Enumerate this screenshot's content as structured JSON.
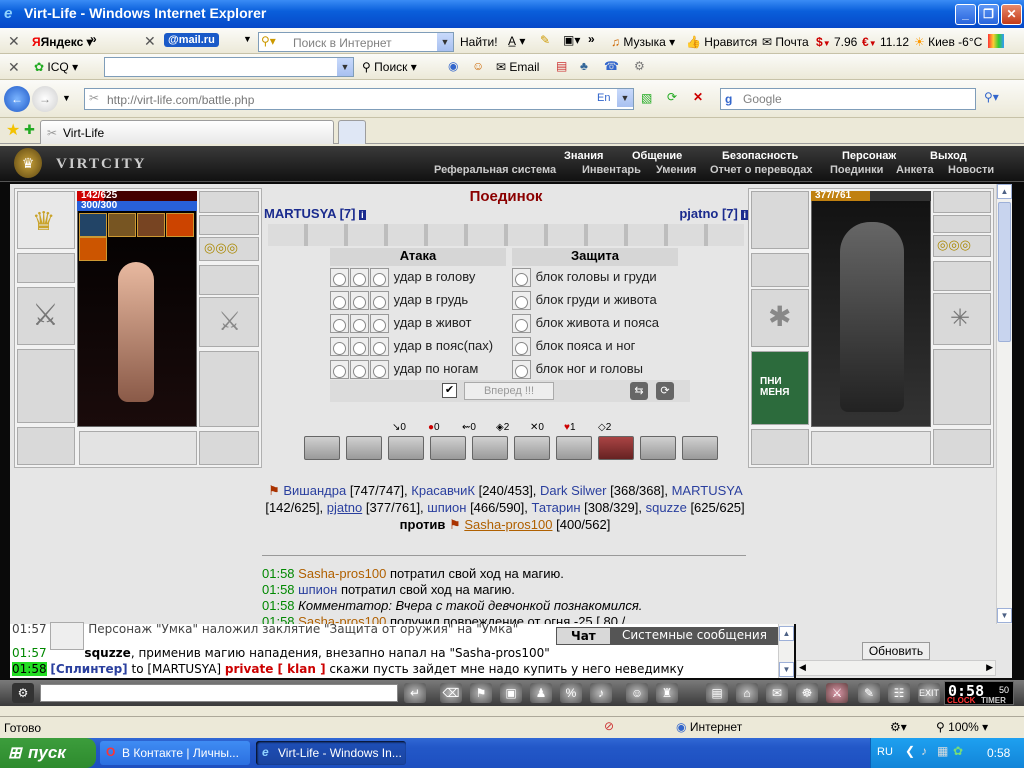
{
  "window": {
    "title": "Virt-Life - Windows Internet Explorer"
  },
  "toolbar1": {
    "yandex": "Яндекс",
    "mail": "@mail.ru",
    "search_placeholder": "Поиск в Интернет",
    "find": "Найти!",
    "music": "Музыка",
    "like": "Нравится",
    "mail_label": "Почта",
    "usd": "7.96",
    "eur": "11.12",
    "weather": "Киев -6°C"
  },
  "toolbar2": {
    "icq": "ICQ",
    "search": "Поиск",
    "email": "Email"
  },
  "address": {
    "url": "http://virt-life.com/battle.php",
    "lang": "En",
    "google_placeholder": "Google"
  },
  "tab": {
    "label": "Virt-Life"
  },
  "game": {
    "logo": "VIRTCITY",
    "menu_top": [
      "Знания",
      "Общение",
      "Безопасность",
      "Персонаж",
      "Выход"
    ],
    "menu_sub": [
      "Реферальная система",
      "Инвентарь",
      "Умения",
      "Отчет о переводах",
      "Поединки",
      "Анкета",
      "Новости"
    ],
    "left_player": {
      "hp": "142/625",
      "mana": "300/300",
      "name": "MARTUSYA [7]"
    },
    "right_player": {
      "hp": "377/761",
      "name": "pjatno [7]"
    },
    "battle_title": "Поединок",
    "attack_header": "Атака",
    "defense_header": "Защита",
    "attacks": [
      "удар в голову",
      "удар в грудь",
      "удар в живот",
      "удар в пояс(пах)",
      "удар по ногам"
    ],
    "defenses": [
      "блок головы и груди",
      "блок груди и живота",
      "блок живота и пояса",
      "блок пояса и ног",
      "блок ног и головы"
    ],
    "forward_button": "Вперед !!!",
    "stats": [
      "0",
      "0",
      "0",
      "2",
      "0",
      "1",
      "2"
    ],
    "teams": {
      "left": [
        {
          "name": "Вишандра",
          "hp": "[747/747],"
        },
        {
          "name": "КрасавчиК",
          "hp": "[240/453],"
        },
        {
          "name": "Dark Silwer",
          "hp": "[368/368],"
        },
        {
          "name": "MARTUSYA",
          "hp": "[142/625],"
        },
        {
          "name": "pjatno",
          "hp": "[377/761],"
        },
        {
          "name": "шпион",
          "hp": "[466/590],"
        },
        {
          "name": "Татарин",
          "hp": "[308/329],"
        },
        {
          "name": "squzze",
          "hp": "[625/625]"
        }
      ],
      "vs": "против",
      "right": [
        {
          "name": "Sasha-pros100",
          "hp": "[400/562]"
        }
      ]
    },
    "log": [
      {
        "time": "01:58",
        "name": "Sasha-pros100",
        "text": "потратил свой ход на магию."
      },
      {
        "time": "01:58",
        "name": "шпион",
        "text": "потратил свой ход на магию."
      },
      {
        "time": "01:58",
        "name": "",
        "text": "Комментатор: Вчера с такой девчонкой познакомился."
      },
      {
        "time": "01:58",
        "name": "Sasha-pros100",
        "text": "получил повреждение от огня -25 [ 80 /"
      }
    ]
  },
  "chat": {
    "lines": [
      {
        "time": "01:57",
        "text": "Персонаж \"Умка\" наложил заклятие \"Защита от оружия\" на \"Умка\""
      },
      {
        "time": "01:57",
        "name": "squzze",
        "text": ", применив магию нападения, внезапно напал на \"Sasha-pros100\""
      },
      {
        "time": "01:58",
        "name": "[Сплинтер]",
        "to": "to [MARTUSYA]",
        "private": "private [ klan ]",
        "text": "скажи пусть зайдет мне надо купить у него неведимку"
      }
    ],
    "tab_chat": "Чат",
    "tab_system": "Системные сообщения",
    "refresh": "Обновить"
  },
  "clock": {
    "time": "0:58",
    "seconds": "50",
    "clock_label": "CLOCK",
    "timer_label": "TIMER"
  },
  "status": {
    "ready": "Готово",
    "zone": "Интернет",
    "zoom": "100%"
  },
  "taskbar": {
    "start": "пуск",
    "tasks": [
      "В Контакте | Личны...",
      "Virt-Life - Windows In..."
    ],
    "lang": "RU",
    "time": "0:58"
  }
}
